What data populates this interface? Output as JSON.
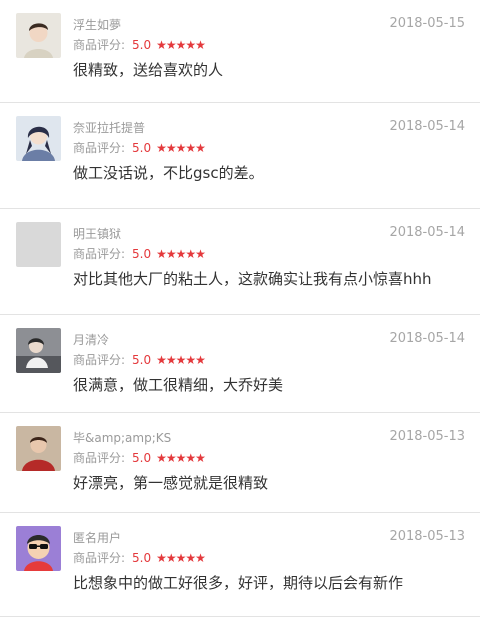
{
  "rating_label": "商品评分:",
  "star_glyph": "★★★★★",
  "accent_color": "#e4393c",
  "reviews": [
    {
      "name": "浮生如夢",
      "date": "2018-05-15",
      "score": "5.0",
      "stars": 5,
      "content": "很精致，送给喜欢的人",
      "avatar_icon": "young-man-avatar-icon"
    },
    {
      "name": "奈亚拉托提普",
      "date": "2018-05-14",
      "score": "5.0",
      "stars": 5,
      "content": "做工没话说，不比gsc的差。",
      "avatar_icon": "anime-character-avatar-icon"
    },
    {
      "name": "明王镇狱",
      "date": "2018-05-14",
      "score": "5.0",
      "stars": 5,
      "content": "对比其他大厂的粘土人，这款确实让我有点小惊喜hhh",
      "avatar_icon": "blank-avatar-icon"
    },
    {
      "name": "月清冷",
      "date": "2018-05-14",
      "score": "5.0",
      "stars": 5,
      "content": "很满意，做工很精细，大乔好美",
      "avatar_icon": "figure-photo-avatar-icon"
    },
    {
      "name": "毕&amp;amp;KS",
      "date": "2018-05-13",
      "score": "5.0",
      "stars": 5,
      "content": "好漂亮，第一感觉就是很精致",
      "avatar_icon": "red-character-avatar-icon"
    },
    {
      "name": "匿名用户",
      "date": "2018-05-13",
      "score": "5.0",
      "stars": 5,
      "content": "比想象中的做工好很多，好评，期待以后会有新作",
      "avatar_icon": "anonymous-cartoon-avatar-icon"
    }
  ]
}
